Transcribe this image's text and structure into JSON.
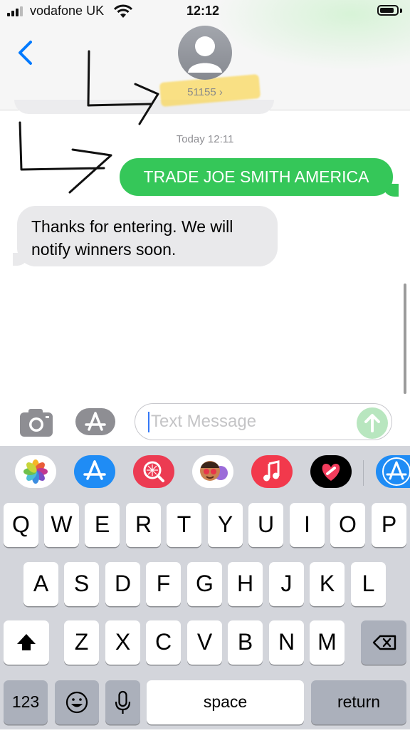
{
  "status_bar": {
    "carrier": "vodafone UK",
    "time": "12:12",
    "battery_level": 0.85
  },
  "header": {
    "contact_name": "51155 ›"
  },
  "conversation": {
    "timestamp": "Today 12:11",
    "messages": [
      {
        "direction": "sent",
        "text": "TRADE JOE SMITH AMERICA"
      },
      {
        "direction": "received",
        "text": "Thanks for entering. We will notify winners soon."
      }
    ]
  },
  "input_bar": {
    "placeholder": "Text Message"
  },
  "app_drawer": [
    "photos-app",
    "app-store-app",
    "web-images-app",
    "memoji-app",
    "music-app",
    "digital-touch-app",
    "app-store-more-app"
  ],
  "keyboard": {
    "row1": [
      "Q",
      "W",
      "E",
      "R",
      "T",
      "Y",
      "U",
      "I",
      "O",
      "P"
    ],
    "row2": [
      "A",
      "S",
      "D",
      "F",
      "G",
      "H",
      "J",
      "K",
      "L"
    ],
    "row3": [
      "Z",
      "X",
      "C",
      "V",
      "B",
      "N",
      "M"
    ],
    "numbers_label": "123",
    "space_label": "space",
    "return_label": "return"
  },
  "colors": {
    "accent": "#007aff",
    "sent_bubble": "#35c759",
    "received_bubble": "#e9e9eb",
    "keyboard_bg": "#d3d5db"
  }
}
